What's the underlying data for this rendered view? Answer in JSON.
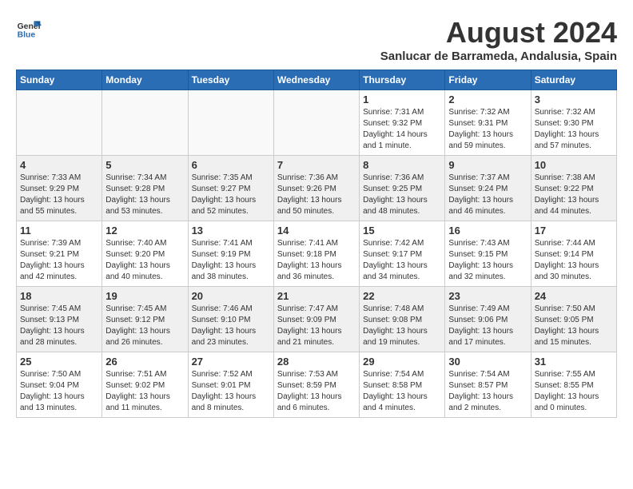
{
  "header": {
    "logo_line1": "General",
    "logo_line2": "Blue",
    "month_year": "August 2024",
    "location": "Sanlucar de Barrameda, Andalusia, Spain"
  },
  "weekdays": [
    "Sunday",
    "Monday",
    "Tuesday",
    "Wednesday",
    "Thursday",
    "Friday",
    "Saturday"
  ],
  "weeks": [
    [
      {
        "day": "",
        "info": ""
      },
      {
        "day": "",
        "info": ""
      },
      {
        "day": "",
        "info": ""
      },
      {
        "day": "",
        "info": ""
      },
      {
        "day": "1",
        "info": "Sunrise: 7:31 AM\nSunset: 9:32 PM\nDaylight: 14 hours\nand 1 minute."
      },
      {
        "day": "2",
        "info": "Sunrise: 7:32 AM\nSunset: 9:31 PM\nDaylight: 13 hours\nand 59 minutes."
      },
      {
        "day": "3",
        "info": "Sunrise: 7:32 AM\nSunset: 9:30 PM\nDaylight: 13 hours\nand 57 minutes."
      }
    ],
    [
      {
        "day": "4",
        "info": "Sunrise: 7:33 AM\nSunset: 9:29 PM\nDaylight: 13 hours\nand 55 minutes."
      },
      {
        "day": "5",
        "info": "Sunrise: 7:34 AM\nSunset: 9:28 PM\nDaylight: 13 hours\nand 53 minutes."
      },
      {
        "day": "6",
        "info": "Sunrise: 7:35 AM\nSunset: 9:27 PM\nDaylight: 13 hours\nand 52 minutes."
      },
      {
        "day": "7",
        "info": "Sunrise: 7:36 AM\nSunset: 9:26 PM\nDaylight: 13 hours\nand 50 minutes."
      },
      {
        "day": "8",
        "info": "Sunrise: 7:36 AM\nSunset: 9:25 PM\nDaylight: 13 hours\nand 48 minutes."
      },
      {
        "day": "9",
        "info": "Sunrise: 7:37 AM\nSunset: 9:24 PM\nDaylight: 13 hours\nand 46 minutes."
      },
      {
        "day": "10",
        "info": "Sunrise: 7:38 AM\nSunset: 9:22 PM\nDaylight: 13 hours\nand 44 minutes."
      }
    ],
    [
      {
        "day": "11",
        "info": "Sunrise: 7:39 AM\nSunset: 9:21 PM\nDaylight: 13 hours\nand 42 minutes."
      },
      {
        "day": "12",
        "info": "Sunrise: 7:40 AM\nSunset: 9:20 PM\nDaylight: 13 hours\nand 40 minutes."
      },
      {
        "day": "13",
        "info": "Sunrise: 7:41 AM\nSunset: 9:19 PM\nDaylight: 13 hours\nand 38 minutes."
      },
      {
        "day": "14",
        "info": "Sunrise: 7:41 AM\nSunset: 9:18 PM\nDaylight: 13 hours\nand 36 minutes."
      },
      {
        "day": "15",
        "info": "Sunrise: 7:42 AM\nSunset: 9:17 PM\nDaylight: 13 hours\nand 34 minutes."
      },
      {
        "day": "16",
        "info": "Sunrise: 7:43 AM\nSunset: 9:15 PM\nDaylight: 13 hours\nand 32 minutes."
      },
      {
        "day": "17",
        "info": "Sunrise: 7:44 AM\nSunset: 9:14 PM\nDaylight: 13 hours\nand 30 minutes."
      }
    ],
    [
      {
        "day": "18",
        "info": "Sunrise: 7:45 AM\nSunset: 9:13 PM\nDaylight: 13 hours\nand 28 minutes."
      },
      {
        "day": "19",
        "info": "Sunrise: 7:45 AM\nSunset: 9:12 PM\nDaylight: 13 hours\nand 26 minutes."
      },
      {
        "day": "20",
        "info": "Sunrise: 7:46 AM\nSunset: 9:10 PM\nDaylight: 13 hours\nand 23 minutes."
      },
      {
        "day": "21",
        "info": "Sunrise: 7:47 AM\nSunset: 9:09 PM\nDaylight: 13 hours\nand 21 minutes."
      },
      {
        "day": "22",
        "info": "Sunrise: 7:48 AM\nSunset: 9:08 PM\nDaylight: 13 hours\nand 19 minutes."
      },
      {
        "day": "23",
        "info": "Sunrise: 7:49 AM\nSunset: 9:06 PM\nDaylight: 13 hours\nand 17 minutes."
      },
      {
        "day": "24",
        "info": "Sunrise: 7:50 AM\nSunset: 9:05 PM\nDaylight: 13 hours\nand 15 minutes."
      }
    ],
    [
      {
        "day": "25",
        "info": "Sunrise: 7:50 AM\nSunset: 9:04 PM\nDaylight: 13 hours\nand 13 minutes."
      },
      {
        "day": "26",
        "info": "Sunrise: 7:51 AM\nSunset: 9:02 PM\nDaylight: 13 hours\nand 11 minutes."
      },
      {
        "day": "27",
        "info": "Sunrise: 7:52 AM\nSunset: 9:01 PM\nDaylight: 13 hours\nand 8 minutes."
      },
      {
        "day": "28",
        "info": "Sunrise: 7:53 AM\nSunset: 8:59 PM\nDaylight: 13 hours\nand 6 minutes."
      },
      {
        "day": "29",
        "info": "Sunrise: 7:54 AM\nSunset: 8:58 PM\nDaylight: 13 hours\nand 4 minutes."
      },
      {
        "day": "30",
        "info": "Sunrise: 7:54 AM\nSunset: 8:57 PM\nDaylight: 13 hours\nand 2 minutes."
      },
      {
        "day": "31",
        "info": "Sunrise: 7:55 AM\nSunset: 8:55 PM\nDaylight: 13 hours\nand 0 minutes."
      }
    ]
  ]
}
